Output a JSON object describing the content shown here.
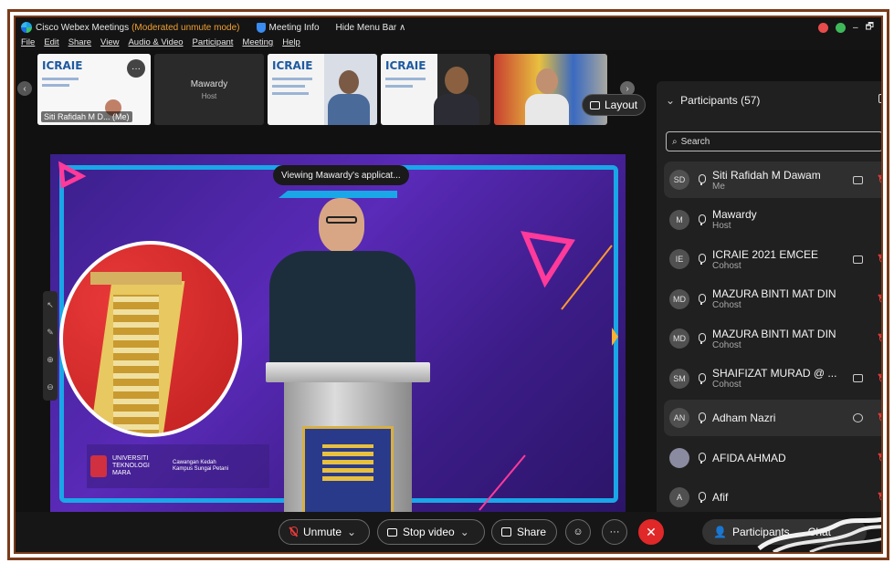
{
  "titlebar": {
    "app_name": "Cisco Webex Meetings",
    "mode": "(Moderated unmute mode)",
    "meeting_info": "Meeting Info",
    "hide_menu": "Hide Menu Bar ∧",
    "minimize": "–",
    "restore": "🗗"
  },
  "menu": [
    "File",
    "Edit",
    "Share",
    "View",
    "Audio & Video",
    "Participant",
    "Meeting",
    "Help"
  ],
  "thumbnails": {
    "self_name": "Siti Rafidah M D... (Me)",
    "host_name": "Mawardy",
    "host_role": "Host",
    "poster_label": "ICRAIE",
    "more_icon": "···"
  },
  "layout_button": "Layout",
  "viewing_banner": "Viewing Mawardy's applicat...",
  "stage": {
    "logo_org": "UNIVERSITI TEKNOLOGI MARA",
    "logo_campus": "Cawangan Kedah Kampus Sungai Petani"
  },
  "panel": {
    "title": "Participants (57)",
    "search_placeholder": "Search",
    "participants": [
      {
        "initials": "SD",
        "name": "Siti Rafidah M Dawam",
        "role": "Me",
        "video": true,
        "muted": true,
        "highlight": true
      },
      {
        "initials": "M",
        "name": "Mawardy",
        "role": "Host",
        "video": false,
        "muted": false,
        "highlight": false
      },
      {
        "initials": "IE",
        "name": "ICRAIE 2021 EMCEE",
        "role": "Cohost",
        "video": true,
        "muted": true,
        "highlight": false
      },
      {
        "initials": "MD",
        "name": "MAZURA BINTI MAT DIN",
        "role": "Cohost",
        "video": false,
        "muted": true,
        "highlight": false
      },
      {
        "initials": "MD",
        "name": "MAZURA BINTI MAT DIN",
        "role": "Cohost",
        "video": false,
        "muted": true,
        "highlight": false
      },
      {
        "initials": "SM",
        "name": "SHAIFIZAT MURAD @ ...",
        "role": "Cohost",
        "video": true,
        "muted": true,
        "highlight": false
      },
      {
        "initials": "AN",
        "name": "Adham Nazri",
        "role": "",
        "video": false,
        "chat": true,
        "muted": true,
        "highlight": true
      },
      {
        "initials": "",
        "name": "AFIDA AHMAD",
        "role": "",
        "video": false,
        "muted": true,
        "highlight": false
      },
      {
        "initials": "A",
        "name": "Afif",
        "role": "",
        "video": false,
        "muted": true,
        "highlight": false
      }
    ]
  },
  "controls": {
    "unmute": "Unmute",
    "stop_video": "Stop video",
    "share": "Share",
    "more": "···",
    "leave": "✕",
    "participants": "Participants",
    "chat": "Chat"
  },
  "colors": {
    "frame": "#7a3b1a",
    "accent_blue": "#1aa7e8",
    "mute_red": "#e83a3a",
    "stage_purple": "#4a24a0"
  }
}
